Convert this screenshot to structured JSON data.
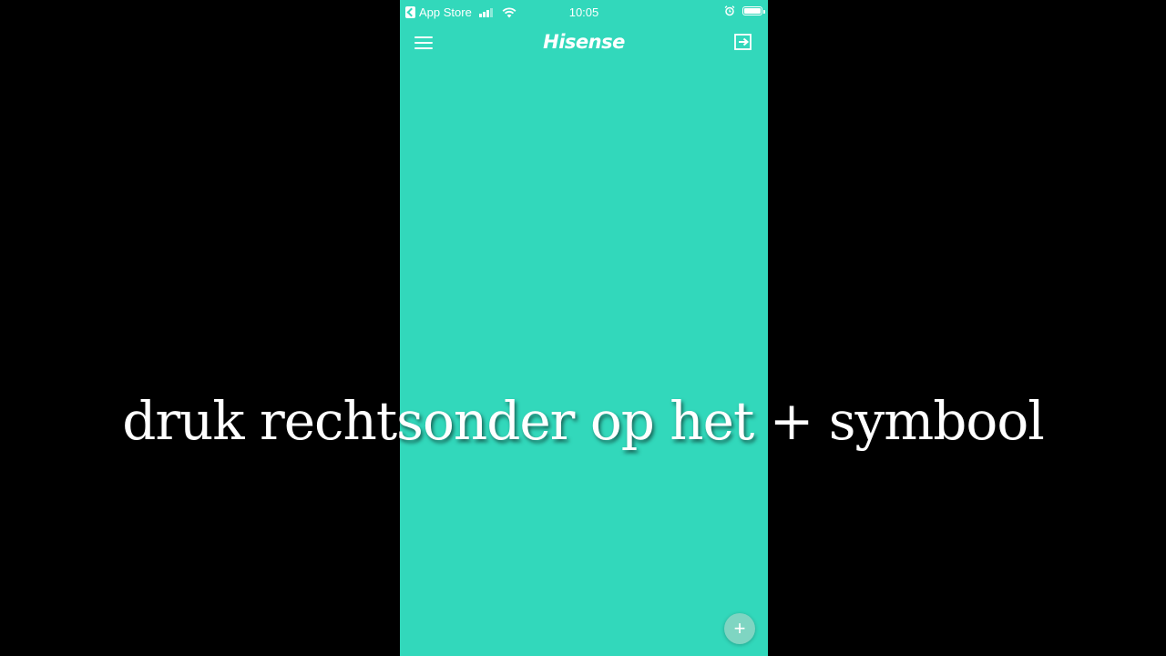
{
  "colors": {
    "background": "#000000",
    "app_background": "#32d8bb",
    "fab_background": "#7fd5c2",
    "foreground": "#ffffff"
  },
  "status_bar": {
    "back_label": "App Store",
    "time": "10:05",
    "icons": [
      "back-arrow-icon",
      "signal-icon",
      "wifi-icon",
      "alarm-icon",
      "battery-icon"
    ]
  },
  "header": {
    "brand": "Hisense",
    "menu_icon": "hamburger-menu-icon",
    "logout_icon": "logout-icon"
  },
  "fab": {
    "symbol": "+",
    "icon": "plus-icon"
  },
  "caption": {
    "text": "druk rechtsonder op het + symbool"
  }
}
